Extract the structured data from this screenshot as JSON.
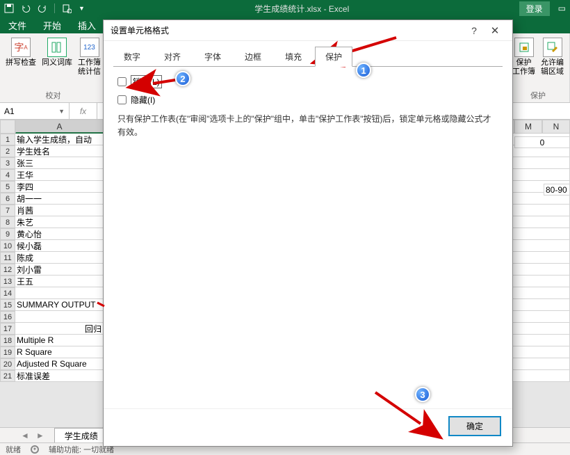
{
  "titlebar": {
    "doc_title": "学生成绩统计.xlsx  -  Excel",
    "login": "登录"
  },
  "ribbon_tabs": {
    "file": "文件",
    "home": "开始",
    "insert": "插入"
  },
  "ribbon": {
    "spellcheck": "拼写检查",
    "thesaurus": "同义词库",
    "workbook_stats": "工作簿\n统计信",
    "protect_workbook": "保护\n工作簿",
    "allow_edit_ranges": "允许编\n辑区域",
    "group_proofing": "校对",
    "group_protect": "保护"
  },
  "namebox": "A1",
  "columns": [
    "A",
    "M",
    "N"
  ],
  "rows": [
    {
      "n": 1,
      "a": "输入学生成绩，自动"
    },
    {
      "n": 2,
      "a": "学生姓名"
    },
    {
      "n": 3,
      "a": "张三"
    },
    {
      "n": 4,
      "a": "王华"
    },
    {
      "n": 5,
      "a": "李四"
    },
    {
      "n": 6,
      "a": "胡一一"
    },
    {
      "n": 7,
      "a": "肖茜"
    },
    {
      "n": 8,
      "a": "朱艺"
    },
    {
      "n": 9,
      "a": "黄心怡"
    },
    {
      "n": 10,
      "a": "候小磊"
    },
    {
      "n": 11,
      "a": "陈成"
    },
    {
      "n": 12,
      "a": "刘小雷"
    },
    {
      "n": 13,
      "a": "王五"
    },
    {
      "n": 14,
      "a": ""
    },
    {
      "n": 15,
      "a": "SUMMARY OUTPUT"
    },
    {
      "n": 16,
      "a": ""
    },
    {
      "n": 17,
      "a": "回归"
    },
    {
      "n": 18,
      "a": "Multiple R"
    },
    {
      "n": 19,
      "a": "R Square"
    },
    {
      "n": 20,
      "a": "Adjusted R Square"
    },
    {
      "n": 21,
      "a": "标准误差"
    }
  ],
  "right_col_M": "0",
  "right_col_N": "80-90",
  "sheettab": "学生成绩",
  "status": {
    "ready": "就绪",
    "acc": "辅助功能: 一切就绪"
  },
  "dialog": {
    "title": "设置单元格格式",
    "tabs": {
      "number": "数字",
      "alignment": "对齐",
      "font": "字体",
      "border": "边框",
      "fill": "填充",
      "protection": "保护"
    },
    "lock": "锁定(L)",
    "hide": "隐藏(I)",
    "note": "只有保护工作表(在\"审阅\"选项卡上的\"保护\"组中，单击\"保护工作表\"按钮)后，锁定单元格或隐藏公式才有效。",
    "ok": "确定"
  },
  "badges": {
    "b1": "1",
    "b2": "2",
    "b3": "3"
  }
}
